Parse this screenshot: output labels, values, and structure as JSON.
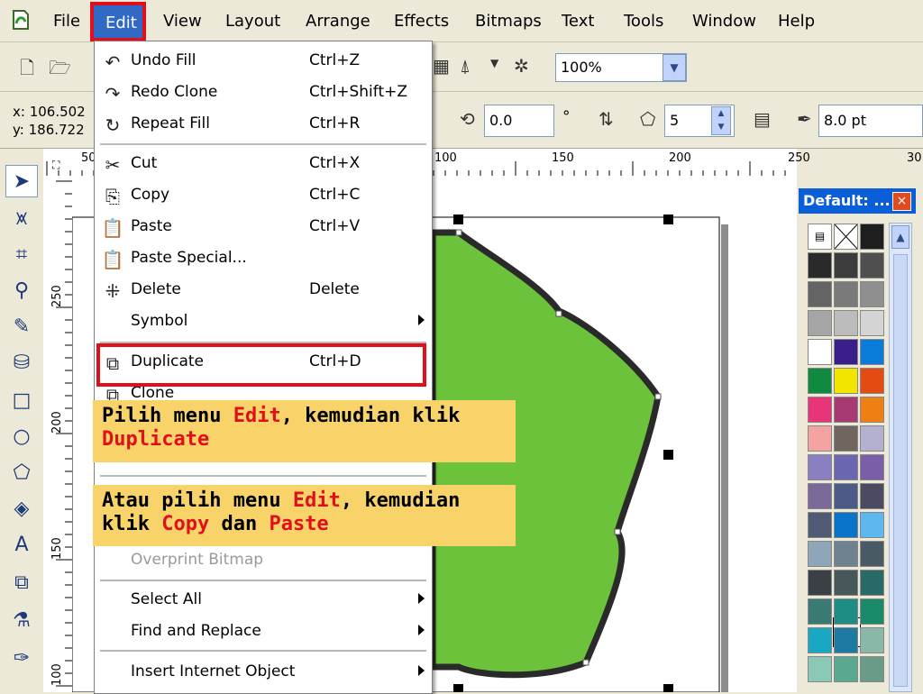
{
  "menubar": {
    "items": [
      {
        "label": "File"
      },
      {
        "label": "Edit"
      },
      {
        "label": "View"
      },
      {
        "label": "Layout"
      },
      {
        "label": "Arrange"
      },
      {
        "label": "Effects"
      },
      {
        "label": "Bitmaps"
      },
      {
        "label": "Text"
      },
      {
        "label": "Tools"
      },
      {
        "label": "Window"
      },
      {
        "label": "Help"
      }
    ]
  },
  "toolbar": {
    "zoom_value": "100%",
    "pos_x": "x: 106.502",
    "pos_y": "y: 186.722",
    "rotation_value": "0.0",
    "degree_symbol": "°",
    "sides_value": "5",
    "outline_width": "8.0 pt"
  },
  "ruler": {
    "top_labels": [
      "50",
      "100",
      "150",
      "200",
      "250",
      "30"
    ],
    "left_labels": [
      "250",
      "200",
      "150",
      "100"
    ]
  },
  "palette": {
    "title": "Default: ...",
    "close_glyph": "×",
    "swatches": [
      "#2a2a2a",
      "#3c3c3c",
      "#4f4f4f",
      "#646464",
      "#7a7a7a",
      "#8f8f8f",
      "#a5a5a5",
      "#bcbcbc",
      "#d4d4d4",
      "#ffffff",
      "#3a1f8a",
      "#0a7bd8",
      "#0f8a3e",
      "#f2e600",
      "#e34b12",
      "#e8357a",
      "#a83a72",
      "#ee7f12",
      "#f5a2a2",
      "#6f6660",
      "#b3b0d0",
      "#8a7fc0",
      "#6a66b0",
      "#7a5fa8",
      "#7a6a9a",
      "#4d5a88",
      "#4a4a62",
      "#505a72",
      "#0a74c8",
      "#5eb8f0",
      "#8ea6b8",
      "#6f8290",
      "#4a5a64",
      "#3a4046",
      "#48585a",
      "#2a6a66",
      "#3a7a74",
      "#1e8e84",
      "#1a8a6a",
      "#18a8c4",
      "#1e7aa2",
      "#8ab8a8",
      "#8ac8b8",
      "#5aa890",
      "#6a9a88"
    ]
  },
  "menu": {
    "items": [
      {
        "label": "Undo Fill",
        "shortcut": "Ctrl+Z"
      },
      {
        "label": "Redo Clone",
        "shortcut": "Ctrl+Shift+Z"
      },
      {
        "label": "Repeat Fill",
        "shortcut": "Ctrl+R"
      },
      {
        "label": "Cut",
        "shortcut": "Ctrl+X"
      },
      {
        "label": "Copy",
        "shortcut": "Ctrl+C"
      },
      {
        "label": "Paste",
        "shortcut": "Ctrl+V"
      },
      {
        "label": "Paste Special...",
        "shortcut": ""
      },
      {
        "label": "Delete",
        "shortcut": "Delete"
      },
      {
        "label": "Symbol",
        "shortcut": ""
      },
      {
        "label": "Duplicate",
        "shortcut": "Ctrl+D"
      },
      {
        "label": "Clone",
        "shortcut": ""
      },
      {
        "label": "Overprint Bitmap",
        "shortcut": ""
      },
      {
        "label": "Select All",
        "shortcut": ""
      },
      {
        "label": "Find and Replace",
        "shortcut": ""
      },
      {
        "label": "Insert Internet Object",
        "shortcut": ""
      }
    ]
  },
  "callouts": {
    "c1": {
      "t1": "Pilih menu ",
      "t2": "Edit",
      "t3": ", kemudian klik",
      "t4": "Duplicate"
    },
    "c2": {
      "t1": "Atau pilih menu ",
      "t2": "Edit",
      "t3": ", kemudian",
      "t4": "klik ",
      "t5": "Copy",
      "t6": " dan ",
      "t7": "Paste"
    }
  },
  "colors": {
    "shape_fill": "#6cc23a",
    "shape_stroke": "#2a2a2a",
    "highlight_red": "#e0101a",
    "callout_bg": "#f8d36a"
  }
}
